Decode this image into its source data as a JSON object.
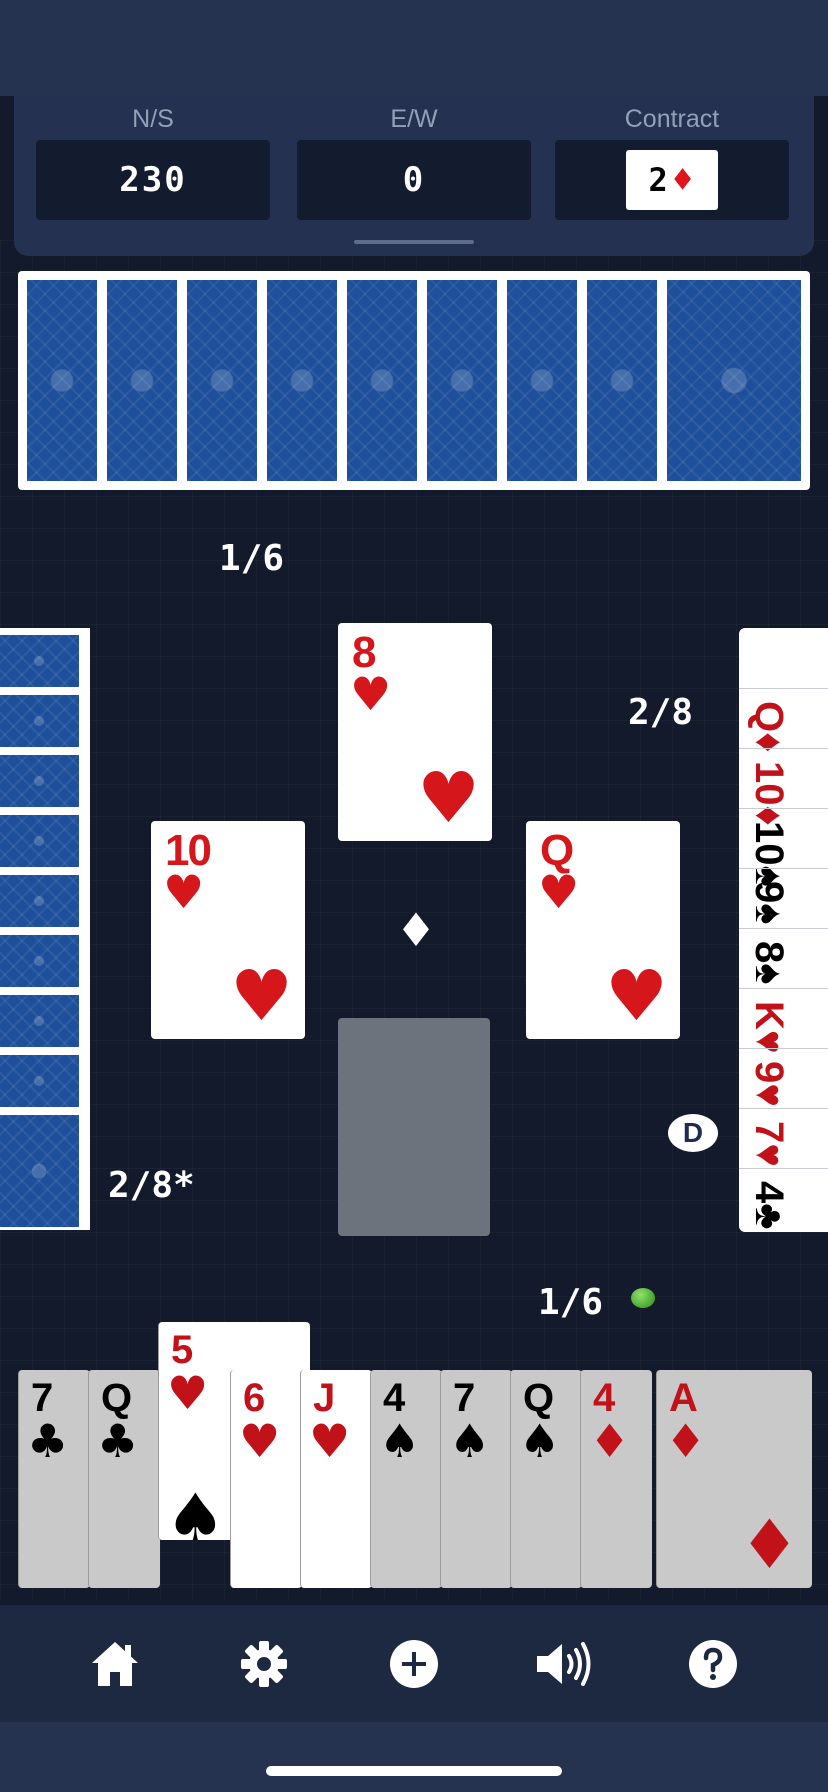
{
  "scoreboard": {
    "ns_label": "N/S",
    "ns_score": "230",
    "ew_label": "E/W",
    "ew_score": "0",
    "contract_label": "Contract",
    "contract_level": "2",
    "contract_suit": "♦"
  },
  "labels": {
    "north_tricks": "1/6",
    "east_tricks": "2/8",
    "west_tricks": "2/8*",
    "south_tricks": "1/6",
    "dealer": "D"
  },
  "table": {
    "trump_symbol": "♦",
    "north_played": {
      "rank": "8",
      "suit": "♥"
    },
    "west_played": {
      "rank": "10",
      "suit": "♥"
    },
    "east_played": {
      "rank": "Q",
      "suit": "♥"
    }
  },
  "east_hand": [
    {
      "rank": "Q",
      "suit": "♦",
      "color": "red"
    },
    {
      "rank": "10",
      "suit": "♦",
      "color": "red"
    },
    {
      "rank": "10",
      "suit": "♠",
      "color": "black"
    },
    {
      "rank": "9",
      "suit": "♠",
      "color": "black"
    },
    {
      "rank": "8",
      "suit": "♠",
      "color": "black"
    },
    {
      "rank": "K",
      "suit": "♥",
      "color": "red"
    },
    {
      "rank": "9",
      "suit": "♥",
      "color": "red"
    },
    {
      "rank": "7",
      "suit": "♥",
      "color": "red"
    },
    {
      "rank": "4",
      "suit": "♣",
      "color": "black"
    }
  ],
  "south_hand": [
    {
      "rank": "7",
      "suit": "♣",
      "color": "black"
    },
    {
      "rank": "Q",
      "suit": "♣",
      "color": "black"
    },
    {
      "rank": "5",
      "suit": "♥",
      "color": "red",
      "lifted": true
    },
    {
      "rank": "6",
      "suit": "♥",
      "color": "red"
    },
    {
      "rank": "J",
      "suit": "♥",
      "color": "red"
    },
    {
      "rank": "4",
      "suit": "♠",
      "color": "black"
    },
    {
      "rank": "7",
      "suit": "♠",
      "color": "black"
    },
    {
      "rank": "Q",
      "suit": "♠",
      "color": "black"
    },
    {
      "rank": "4",
      "suit": "♦",
      "color": "red"
    },
    {
      "rank": "A",
      "suit": "♦",
      "color": "red"
    }
  ],
  "lifted_card_bottom_suit": "♠",
  "navigation": [
    "home-icon",
    "settings-gear-icon",
    "new-game-plus-icon",
    "sound-icon",
    "help-icon"
  ],
  "colors": {
    "red_suit": "#d5171c",
    "card_back": "#1d4f9a",
    "table": "#121a2b"
  }
}
